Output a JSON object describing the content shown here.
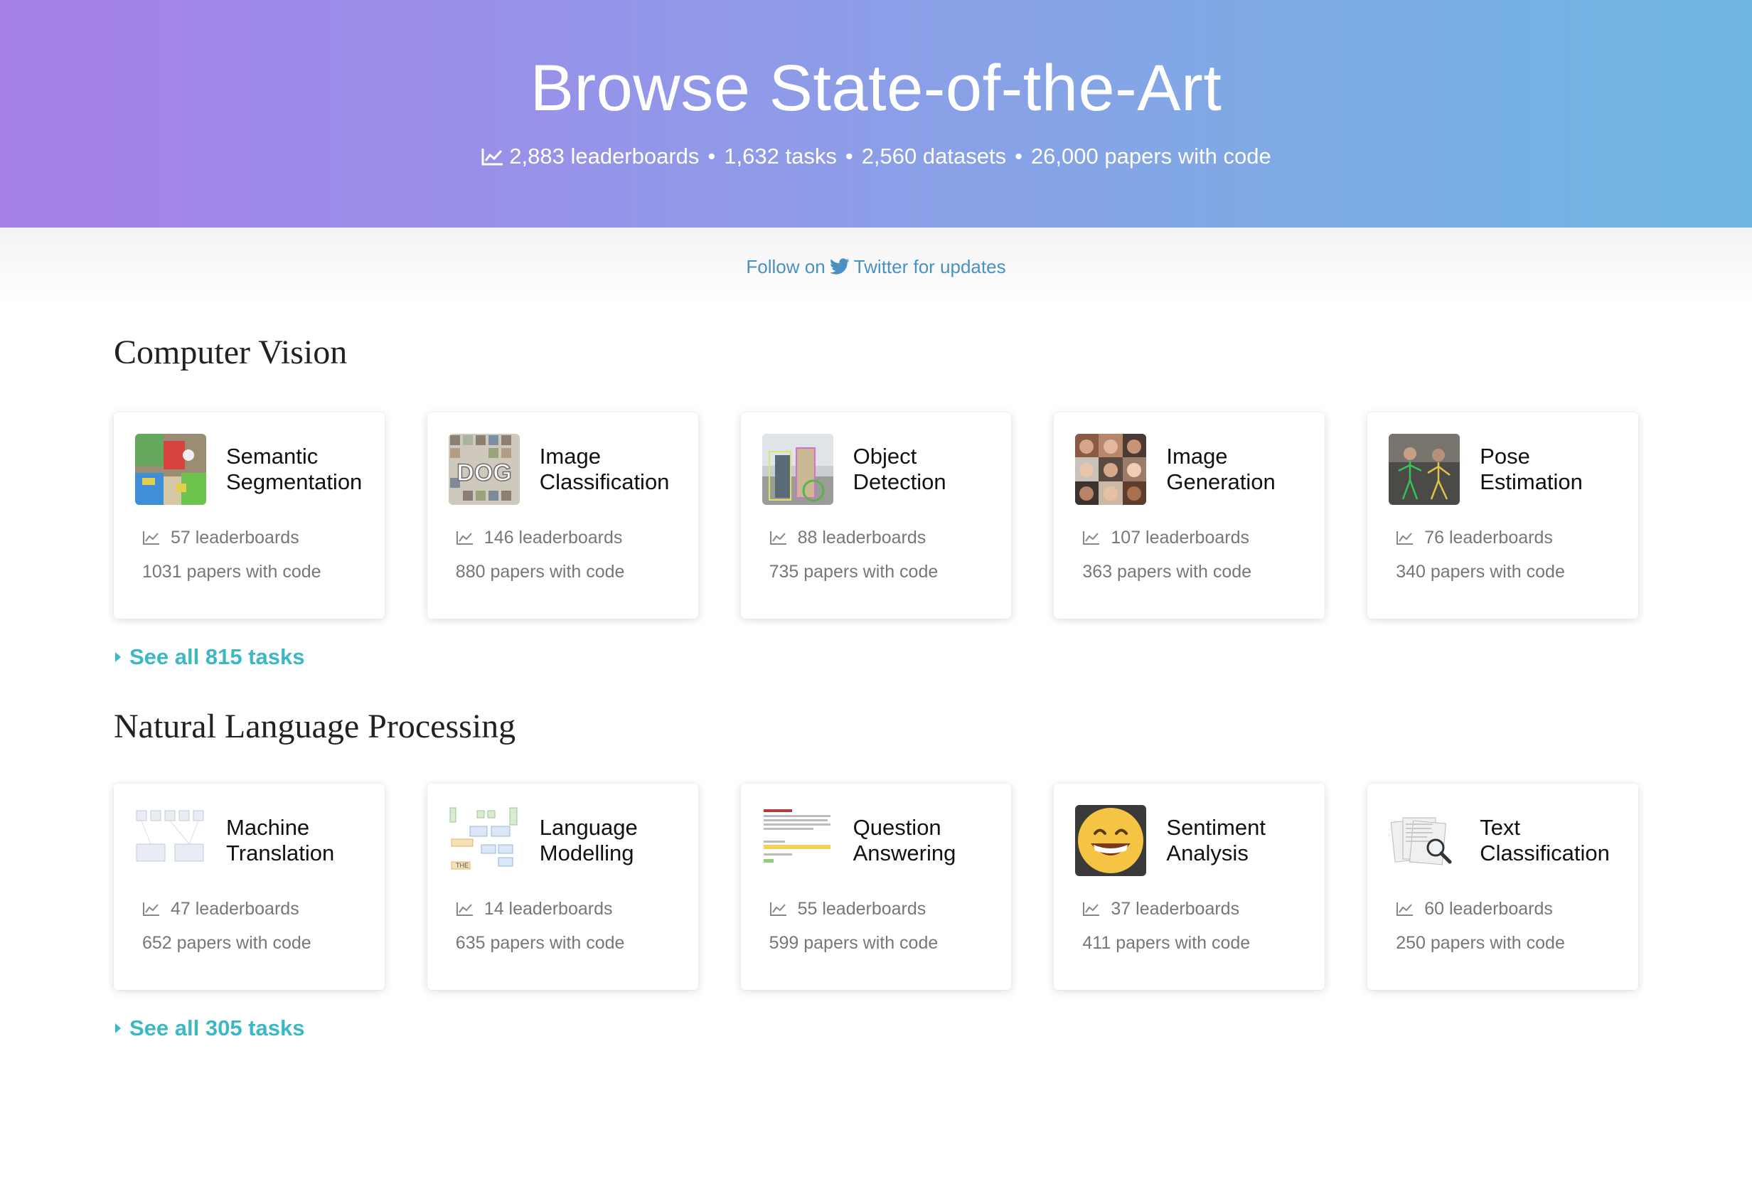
{
  "hero": {
    "title": "Browse State-of-the-Art",
    "stats": [
      "2,883 leaderboards",
      "1,632 tasks",
      "2,560 datasets",
      "26,000 papers with code"
    ],
    "separator": "•"
  },
  "follow": {
    "prefix": "Follow on",
    "link": "Twitter for updates"
  },
  "sections": [
    {
      "title": "Computer Vision",
      "see_all": "See all 815 tasks",
      "cards": [
        {
          "title_1": "Semantic",
          "title_2": "Segmentation",
          "leaderboards": "57 leaderboards",
          "papers": "1031 papers with code",
          "thumb": "segmentation-thumbnail"
        },
        {
          "title_1": "Image",
          "title_2": "Classification",
          "leaderboards": "146 leaderboards",
          "papers": "880 papers with code",
          "thumb": "image-grid-thumbnail"
        },
        {
          "title_1": "Object",
          "title_2": "Detection",
          "leaderboards": "88 leaderboards",
          "papers": "735 papers with code",
          "thumb": "street-photo-thumbnail"
        },
        {
          "title_1": "Image",
          "title_2": "Generation",
          "leaderboards": "107 leaderboards",
          "papers": "363 papers with code",
          "thumb": "faces-grid-thumbnail"
        },
        {
          "title_1": "Pose",
          "title_2": "Estimation",
          "leaderboards": "76 leaderboards",
          "papers": "340 papers with code",
          "thumb": "pose-photo-thumbnail"
        }
      ]
    },
    {
      "title": "Natural Language Processing",
      "see_all": "See all 305 tasks",
      "cards": [
        {
          "title_1": "Machine",
          "title_2": "Translation",
          "leaderboards": "47 leaderboards",
          "papers": "652 papers with code",
          "thumb": "translation-diagram-thumbnail"
        },
        {
          "title_1": "Language",
          "title_2": "Modelling",
          "leaderboards": "14 leaderboards",
          "papers": "635 papers with code",
          "thumb": "model-diagram-thumbnail"
        },
        {
          "title_1": "Question",
          "title_2": "Answering",
          "leaderboards": "55 leaderboards",
          "papers": "599 papers with code",
          "thumb": "qa-document-thumbnail"
        },
        {
          "title_1": "Sentiment",
          "title_2": "Analysis",
          "leaderboards": "37 leaderboards",
          "papers": "411 papers with code",
          "thumb": "smiley-emoji-thumbnail"
        },
        {
          "title_1": "Text",
          "title_2": "Classification",
          "leaderboards": "60 leaderboards",
          "papers": "250 papers with code",
          "thumb": "documents-magnifier-thumbnail"
        }
      ]
    }
  ],
  "colors": {
    "hero_gradient_start": "#a67fe9",
    "hero_gradient_end": "#6fb8e2",
    "link_blue": "#4a90c2",
    "see_all_teal": "#3cb7c4"
  }
}
